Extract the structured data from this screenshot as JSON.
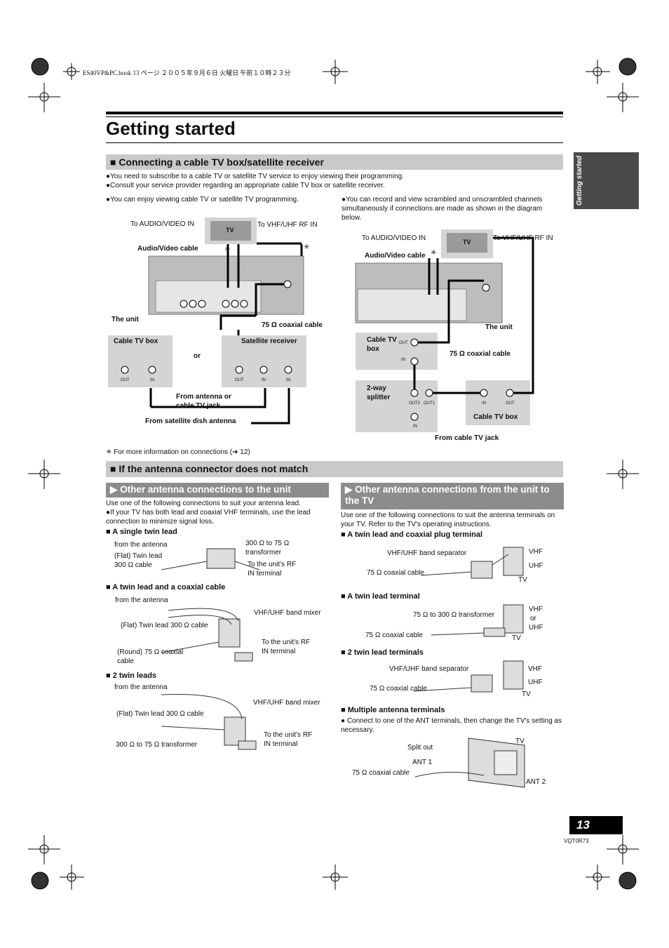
{
  "header_line": "ES40VP&PC.book  13 ページ  ２００５年９月６日  火曜日  午前１０時２３分",
  "title": "Getting started",
  "side_tab": "Getting started",
  "section1": {
    "heading": "■ Connecting a cable TV box/satellite receiver",
    "bullets": [
      "●You need to subscribe to a cable TV or satellite TV service to enjoy viewing their programming.",
      "●Consult your service provider regarding an appropriate cable TV box or satellite receiver."
    ],
    "left_note": "●You can enjoy viewing cable TV or satellite TV programming.",
    "right_note": "●You can record and view scrambled and unscrambled channels simultaneously if connections are made as shown in the diagram below.",
    "left_diagram": {
      "to_av_in": "To AUDIO/VIDEO IN",
      "tv": "TV",
      "to_rf_in": "To VHF/UHF RF IN",
      "av_cable": "Audio/Video cable",
      "asterisk": "✳",
      "the_unit": "The unit",
      "coax": "75 Ω coaxial cable",
      "cable_box": "Cable TV box",
      "or": "or",
      "satellite": "Satellite receiver",
      "out": "OUT",
      "in": "IN",
      "from_antenna": "From antenna or cable TV jack",
      "from_dish": "From satellite dish antenna"
    },
    "right_diagram": {
      "to_av_in": "To AUDIO/VIDEO IN",
      "tv": "TV",
      "to_rf_in": "To VHF/UHF RF IN",
      "av_cable": "Audio/Video cable",
      "asterisk": "✳",
      "the_unit": "The unit",
      "cable_box": "Cable TV box",
      "coax": "75 Ω coaxial cable",
      "splitter": "2-way splitter",
      "out": "OUT",
      "in": "IN",
      "out1": "OUT1",
      "out2": "OUT2",
      "cable_box2": "Cable TV box",
      "from_jack": "From cable TV jack"
    },
    "footnote": "✳ For more information on connections (➜ 12)"
  },
  "section2": {
    "heading": "■ If the antenna connector does not match",
    "left": {
      "heading": "▶ Other antenna connections to the unit",
      "intro": "Use one of the following connections to suit your antenna lead.",
      "bullet": "●If your TV has both lead and coaxial VHF terminals, use the lead connection to minimize signal loss.",
      "items": [
        {
          "title": "■ A single twin lead",
          "labels": [
            "from the antenna",
            "(Flat) Twin lead 300 Ω cable",
            "300 Ω to 75 Ω transformer",
            "To the unit's RF IN terminal"
          ]
        },
        {
          "title": "■ A twin lead and a coaxial cable",
          "labels": [
            "from the antenna",
            "VHF/UHF band mixer",
            "(Flat) Twin lead 300 Ω cable",
            "To the unit's RF IN terminal",
            "(Round) 75 Ω coaxial cable"
          ]
        },
        {
          "title": "■ 2 twin leads",
          "labels": [
            "from the antenna",
            "VHF/UHF band mixer",
            "(Flat) Twin lead 300 Ω cable",
            "To the unit's RF IN terminal",
            "300 Ω to 75 Ω transformer"
          ]
        }
      ]
    },
    "right": {
      "heading": "▶ Other antenna connections from the unit to the TV",
      "intro": "Use one of the following connections to suit the antenna terminals on your TV. Refer to the TV's operating instructions.",
      "items": [
        {
          "title": "■ A twin lead and coaxial plug terminal",
          "labels": [
            "VHF/UHF band separator",
            "75 Ω coaxial cable",
            "VHF",
            "UHF",
            "TV"
          ]
        },
        {
          "title": "■ A twin lead terminal",
          "labels": [
            "75 Ω to 300 Ω transformer",
            "75 Ω coaxial cable",
            "VHF",
            "or",
            "UHF",
            "TV"
          ]
        },
        {
          "title": "■ 2 twin lead terminals",
          "labels": [
            "VHF/UHF band separator",
            "75 Ω coaxial cable",
            "VHF",
            "UHF",
            "TV"
          ]
        },
        {
          "title": "■ Multiple antenna terminals",
          "bullet": "● Connect to one of the ANT terminals, then change the TV's setting as necessary.",
          "labels": [
            "TV",
            "Split out",
            "ANT 1",
            "75 Ω coaxial cable",
            "ANT 2"
          ]
        }
      ]
    }
  },
  "page_number": "13",
  "doc_code": "VQT0R73",
  "colors": {
    "section_bar": "#c9c9c9",
    "sub_bar": "#8c8c8c",
    "side_tab": "#4a4a4a",
    "page_box": "#000000"
  }
}
